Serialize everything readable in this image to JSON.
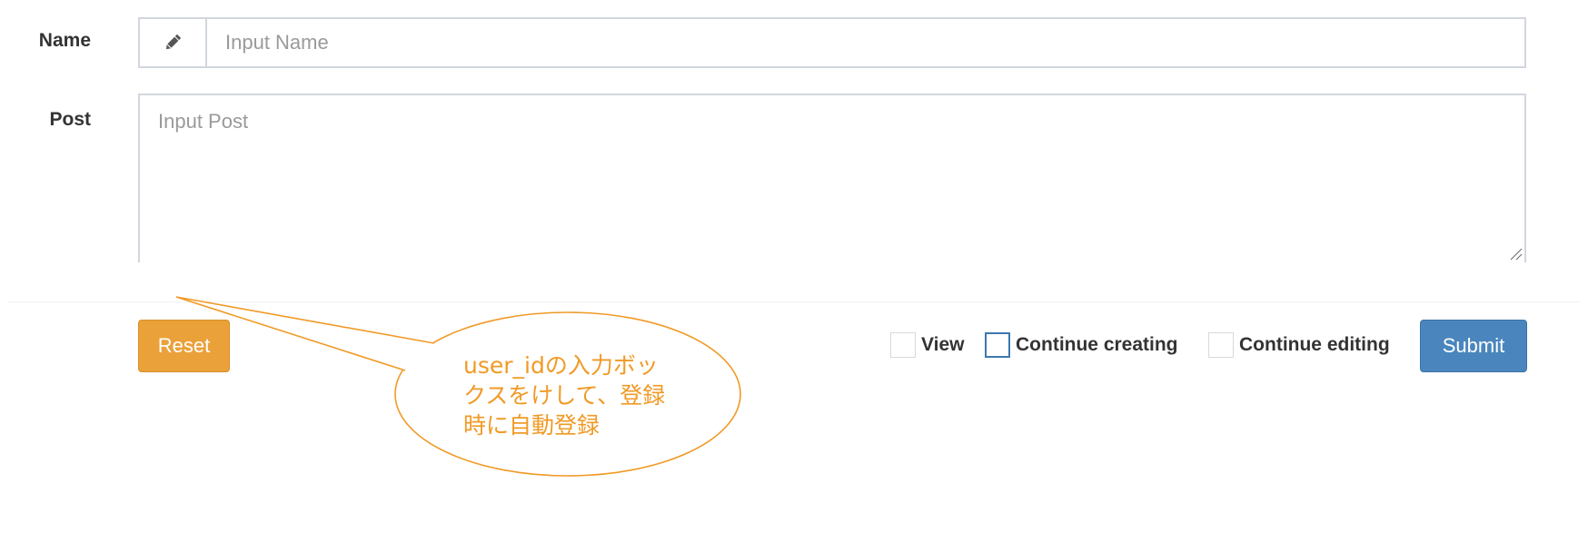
{
  "form": {
    "name_label": "Name",
    "name_placeholder": "Input Name",
    "name_icon": "pencil-icon",
    "post_label": "Post",
    "post_placeholder": "Input Post"
  },
  "footer": {
    "reset_label": "Reset",
    "checkboxes": [
      {
        "label": "View",
        "checked": false
      },
      {
        "label": "Continue creating",
        "checked": false,
        "focused": true
      },
      {
        "label": "Continue editing",
        "checked": false
      }
    ],
    "submit_label": "Submit"
  },
  "annotation": {
    "text": "user_idの入力ボックスをけして、登録時に自動登録",
    "color": "#f09a26"
  },
  "colors": {
    "reset": "#eba13a",
    "submit": "#4a86bd",
    "border": "#d2d6de"
  }
}
